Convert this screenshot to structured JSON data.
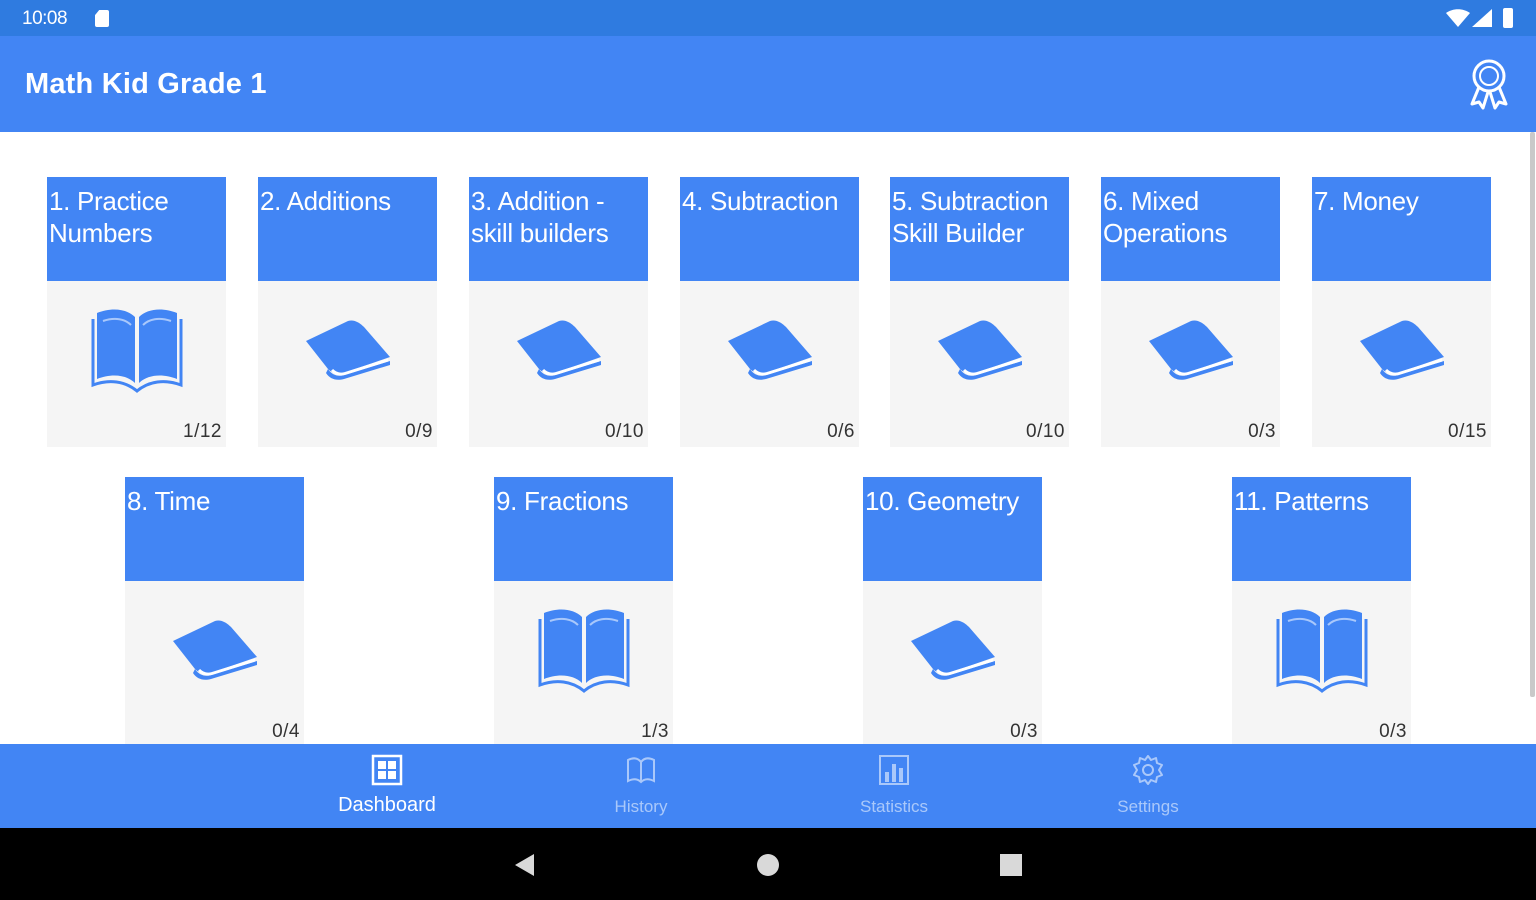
{
  "status_bar": {
    "time": "10:08",
    "icons": [
      "sd-card-icon",
      "wifi-icon",
      "signal-icon",
      "battery-icon"
    ]
  },
  "app_bar": {
    "title": "Math Kid Grade 1",
    "action_icon": "award-icon",
    "color": "#4285f4"
  },
  "topics": [
    {
      "title": "1. Practice Numbers",
      "progress": "1/12",
      "icon": "open-book-icon"
    },
    {
      "title": "2. Additions",
      "progress": "0/9",
      "icon": "closed-book-icon"
    },
    {
      "title": "3. Addition - skill builders",
      "progress": "0/10",
      "icon": "closed-book-icon"
    },
    {
      "title": "4. Subtraction",
      "progress": "0/6",
      "icon": "closed-book-icon"
    },
    {
      "title": "5. Subtraction Skill Builder",
      "progress": "0/10",
      "icon": "closed-book-icon"
    },
    {
      "title": "6. Mixed Operations",
      "progress": "0/3",
      "icon": "closed-book-icon"
    },
    {
      "title": "7. Money",
      "progress": "0/15",
      "icon": "closed-book-icon"
    },
    {
      "title": "8. Time",
      "progress": "0/4",
      "icon": "closed-book-icon"
    },
    {
      "title": "9. Fractions",
      "progress": "1/3",
      "icon": "open-book-icon"
    },
    {
      "title": "10. Geometry",
      "progress": "0/3",
      "icon": "closed-book-icon"
    },
    {
      "title": "11. Patterns",
      "progress": "0/3",
      "icon": "open-book-icon"
    }
  ],
  "bottom_nav": {
    "items": [
      {
        "label": "Dashboard",
        "icon": "dashboard-icon",
        "active": true
      },
      {
        "label": "History",
        "icon": "history-book-icon",
        "active": false
      },
      {
        "label": "Statistics",
        "icon": "statistics-icon",
        "active": false
      },
      {
        "label": "Settings",
        "icon": "gear-icon",
        "active": false
      }
    ]
  },
  "system_nav": {
    "icons": [
      "back-icon",
      "home-icon",
      "recents-icon"
    ]
  },
  "colors": {
    "status_bar": "#2f7be0",
    "primary": "#4285f4",
    "card_body": "#f5f5f5"
  }
}
